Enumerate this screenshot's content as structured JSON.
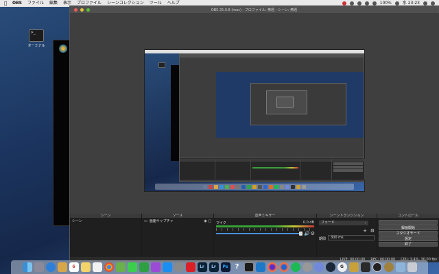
{
  "menubar": {
    "app": "OBS",
    "items": [
      "ファイル",
      "編集",
      "表示",
      "プロファイル",
      "シーンコレクション",
      "ツール",
      "ヘルプ"
    ],
    "battery": "100%",
    "clock": "水 23:23"
  },
  "desktop": {
    "terminal_label": "ターミナル"
  },
  "window": {
    "title": "OBS 25.0.8 (mac) - プロファイル: 無題 - シーン: 無題"
  },
  "panels": {
    "scenes": {
      "title": "シーン",
      "items": [
        "シーン"
      ]
    },
    "sources": {
      "title": "ソース",
      "items": [
        "画面キャプチャ"
      ]
    },
    "mixer": {
      "title": "音声ミキサー",
      "track": "マイク",
      "db": "0.0 dB"
    },
    "transitions": {
      "title": "シーントランジション",
      "selected": "フェード",
      "duration_label": "期間",
      "duration": "300 ms"
    },
    "controls": {
      "title": "コントロール",
      "buttons": [
        "録画開始",
        "スタジオモード",
        "設定",
        "終了"
      ]
    }
  },
  "status": {
    "live": "LIVE: 00:00:00",
    "rec": "REC: 00:00:00",
    "cpu": "CPU: 3.4%, 30.00 fps"
  },
  "dock": {
    "apps": [
      "Finder",
      "Launchpad",
      "Safari",
      "Photos",
      "Calendar",
      "Notes",
      "Reminders",
      "Chrome",
      "Maps",
      "Messages",
      "FaceTime",
      "Podcasts",
      "App Store",
      "Preferences",
      "Creative Cloud",
      "Lightroom Classic",
      "Lightroom",
      "Photoshop",
      "Help",
      "Terminal",
      "VS Code",
      "Firefox",
      "Firefox Dev",
      "Spotify",
      "Music",
      "Discord",
      "Steam",
      "GitHub",
      "League",
      "Activity",
      "OBS",
      "Lol",
      "Utilities",
      "Trash"
    ],
    "labels": [
      "Lr",
      "Lr",
      "Ps"
    ]
  }
}
